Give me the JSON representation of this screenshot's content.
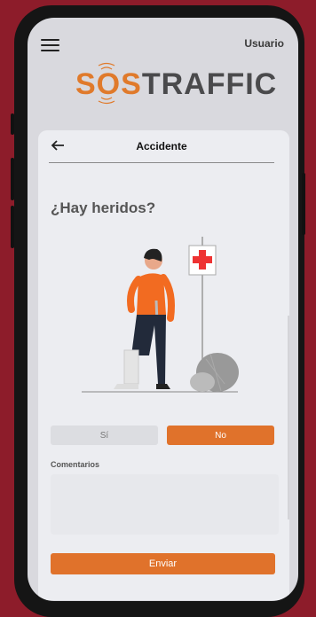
{
  "header": {
    "menu_icon": "hamburger-menu-icon",
    "user_label": "Usuario"
  },
  "logo": {
    "part1": "SOS",
    "part2": "TRAFFIC",
    "colors": {
      "sos": "#e07a2b",
      "traffic": "#4a4a4c"
    }
  },
  "card": {
    "back_icon": "arrow-left-icon",
    "title": "Accidente",
    "question": "¿Hay heridos?",
    "illustration": "injured-person-with-crutch-and-first-aid-sign"
  },
  "answers": {
    "si_label": "Sí",
    "no_label": "No",
    "selected": "No"
  },
  "comments": {
    "label": "Comentarios",
    "value": ""
  },
  "submit": {
    "label": "Enviar"
  },
  "colors": {
    "accent": "#e0722b",
    "background": "#8d1c2a"
  }
}
